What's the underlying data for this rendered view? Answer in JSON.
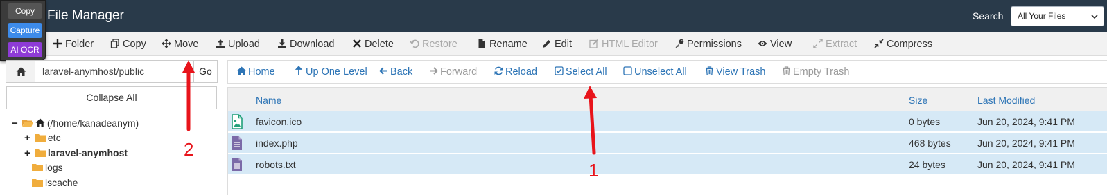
{
  "header": {
    "title": "File Manager",
    "search_label": "Search",
    "search_scope": "All Your Files"
  },
  "overlay_tool": {
    "copy": "Copy",
    "capture": "Capture",
    "ocr": "AI OCR"
  },
  "toolbar": {
    "folder": "Folder",
    "copy": "Copy",
    "move": "Move",
    "upload": "Upload",
    "download": "Download",
    "delete": "Delete",
    "restore": "Restore",
    "rename": "Rename",
    "edit": "Edit",
    "html_editor": "HTML Editor",
    "permissions": "Permissions",
    "view": "View",
    "extract": "Extract",
    "compress": "Compress"
  },
  "path_bar": {
    "path": "laravel-anymhost/public",
    "go": "Go"
  },
  "collapse_all": "Collapse All",
  "tree": [
    {
      "label": "(/home/kanadeanym)",
      "toggle": "−"
    },
    {
      "label": "etc",
      "toggle": "+"
    },
    {
      "label": "laravel-anymhost",
      "toggle": "+"
    },
    {
      "label": "logs",
      "toggle": ""
    },
    {
      "label": "lscache",
      "toggle": ""
    }
  ],
  "nav": {
    "home": "Home",
    "up": "Up One Level",
    "back": "Back",
    "forward": "Forward",
    "reload": "Reload",
    "select_all": "Select All",
    "unselect_all": "Unselect All",
    "view_trash": "View Trash",
    "empty_trash": "Empty Trash"
  },
  "table": {
    "headers": {
      "name": "Name",
      "size": "Size",
      "modified": "Last Modified"
    },
    "rows": [
      {
        "name": "favicon.ico",
        "size": "0 bytes",
        "modified": "Jun 20, 2024, 9:41 PM",
        "icon": "image-file-icon"
      },
      {
        "name": "index.php",
        "size": "468 bytes",
        "modified": "Jun 20, 2024, 9:41 PM",
        "icon": "text-file-icon"
      },
      {
        "name": "robots.txt",
        "size": "24 bytes",
        "modified": "Jun 20, 2024, 9:41 PM",
        "icon": "text-file-icon"
      }
    ]
  },
  "annotations": {
    "label_1": "1",
    "label_2": "2",
    "color": "#e8141b"
  }
}
